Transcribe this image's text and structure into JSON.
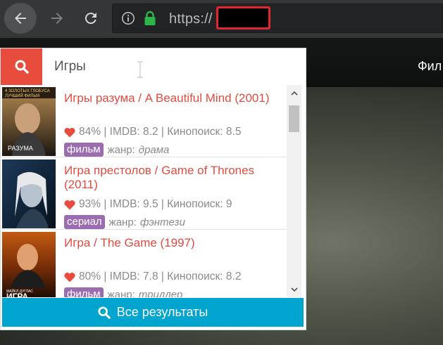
{
  "browser": {
    "url": "https://"
  },
  "page": {
    "nav_text": "Фил"
  },
  "search": {
    "query": "Игры"
  },
  "results": [
    {
      "title": "Игры разума / A Beautiful Mind (2001)",
      "rating": "84% | IMDB: 8.2 | Кинопоиск: 8.5",
      "type": "фильм",
      "genre_label": "жанр:",
      "genre": "драма",
      "poster_text": "РАЗУМА",
      "poster_banner": "4 ЗОЛОТЫХ ГЛОБУСА\nЛУЧШИЙ ФИЛЬМ"
    },
    {
      "title": "Игра престолов / Game of Thrones (2011)",
      "rating": "93% | IMDB: 9.5 | Кинопоиск: 9",
      "type": "сериал",
      "genre_label": "жанр:",
      "genre": "фэнтези",
      "poster_text": ""
    },
    {
      "title": "Игра / The Game (1997)",
      "rating": "80% | IMDB: 7.8 | Кинопоиск: 8.2",
      "type": "фильм",
      "genre_label": "жанр:",
      "genre": "триллер",
      "poster_text": "ИГРА",
      "poster_subtitle": "МАЙКЛ ДУГЛАС"
    }
  ],
  "all_results_label": "Все результаты",
  "colors": {
    "accent_red": "#e74c3c",
    "title_red": "#e24b3f",
    "badge_purple": "#9b6db0",
    "button_blue": "#00a5cf",
    "heart": "#e74c3c"
  },
  "icons": {
    "back": "back-arrow-icon",
    "forward": "forward-arrow-icon",
    "reload": "reload-icon",
    "info": "info-icon",
    "lock": "lock-icon",
    "search": "search-icon",
    "heart": "heart-icon"
  }
}
